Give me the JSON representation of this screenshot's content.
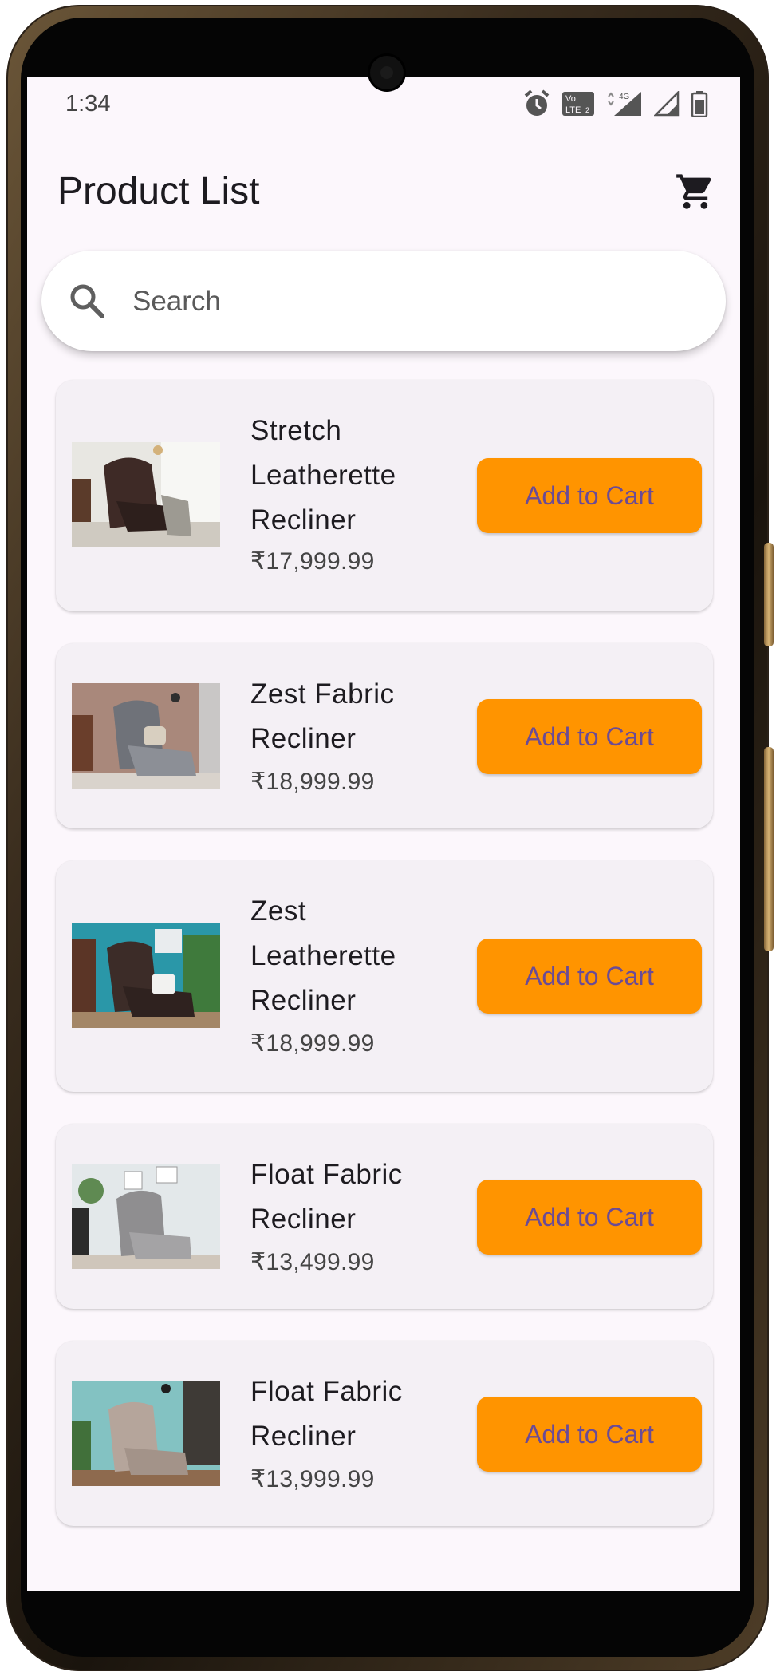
{
  "status_bar": {
    "time": "1:34",
    "icons": [
      "alarm-icon",
      "volte-icon",
      "4g-signal-icon",
      "cell-signal-icon",
      "battery-icon"
    ]
  },
  "app_bar": {
    "title": "Product List",
    "cart_icon": "shopping-cart-icon"
  },
  "search": {
    "placeholder": "Search",
    "icon": "search-icon"
  },
  "colors": {
    "accent": "#ff9400",
    "button_text": "#6b4b95",
    "screen_background": "#fcf7fc",
    "card_background": "#f4f0f5"
  },
  "products": [
    {
      "name_lines": [
        "Stretch",
        "Leatherette",
        "Recliner"
      ],
      "price": "₹17,999.99",
      "button_label": "Add to Cart"
    },
    {
      "name_lines": [
        "Zest Fabric",
        "Recliner"
      ],
      "price": "₹18,999.99",
      "button_label": "Add to Cart"
    },
    {
      "name_lines": [
        "Zest",
        "Leatherette",
        "Recliner"
      ],
      "price": "₹18,999.99",
      "button_label": "Add to Cart"
    },
    {
      "name_lines": [
        "Float Fabric",
        "Recliner"
      ],
      "price": "₹13,499.99",
      "button_label": "Add to Cart"
    },
    {
      "name_lines": [
        "Float Fabric",
        "Recliner"
      ],
      "price": "₹13,999.99",
      "button_label": "Add to Cart"
    }
  ]
}
